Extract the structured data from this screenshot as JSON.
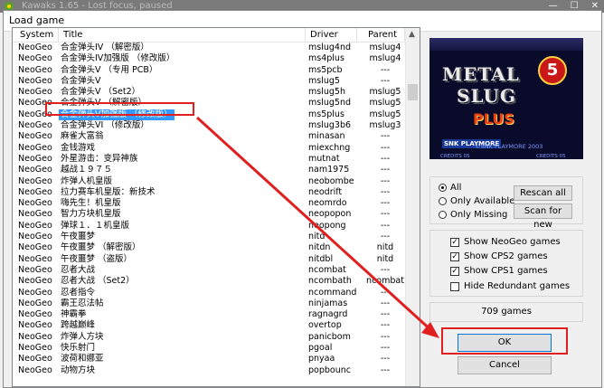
{
  "window": {
    "background_title": "Kawaks 1.65 - Lost focus, paused",
    "controls": [
      "—",
      "☐",
      "✕"
    ]
  },
  "dialog": {
    "title": "Load game"
  },
  "list": {
    "columns": {
      "system": "System",
      "title": "Title",
      "driver": "Driver",
      "parent": "Parent"
    },
    "rows": [
      {
        "system": "NeoGeo",
        "title": "合金弹头IV （解密版）",
        "driver": "mslug4nd",
        "parent": "mslug4"
      },
      {
        "system": "NeoGeo",
        "title": "合金弹头IV加强版 （修改版）",
        "driver": "ms4plus",
        "parent": "mslug4"
      },
      {
        "system": "NeoGeo",
        "title": "合金弹头V （专用 PCB）",
        "driver": "ms5pcb",
        "parent": "---"
      },
      {
        "system": "NeoGeo",
        "title": "合金弹头V",
        "driver": "mslug5",
        "parent": "---"
      },
      {
        "system": "NeoGeo",
        "title": "合金弹头V （Set2）",
        "driver": "mslug5h",
        "parent": "mslug5"
      },
      {
        "system": "NeoGeo",
        "title": "合金弹头V （解密版）",
        "driver": "mslug5nd",
        "parent": "mslug5"
      },
      {
        "system": "NeoGeo",
        "title": "合金弹头V加强版 （修改版）",
        "driver": "ms5plus",
        "parent": "mslug5",
        "selected": true
      },
      {
        "system": "NeoGeo",
        "title": "合金弹头VI （修改版）",
        "driver": "mslug3b6",
        "parent": "mslug3"
      },
      {
        "system": "NeoGeo",
        "title": "麻雀大富翁",
        "driver": "minasan",
        "parent": "---"
      },
      {
        "system": "NeoGeo",
        "title": "金钱游戏",
        "driver": "miexchng",
        "parent": "---"
      },
      {
        "system": "NeoGeo",
        "title": "外星游击：变异神族",
        "driver": "mutnat",
        "parent": "---"
      },
      {
        "system": "NeoGeo",
        "title": "越战１９７５",
        "driver": "nam1975",
        "parent": "---"
      },
      {
        "system": "NeoGeo",
        "title": "炸弹人机皇版",
        "driver": "neobombe",
        "parent": "---"
      },
      {
        "system": "NeoGeo",
        "title": "拉力赛车机皇版：新技术",
        "driver": "neodrift",
        "parent": "---"
      },
      {
        "system": "NeoGeo",
        "title": "嗨先生！机皇版",
        "driver": "neomrdo",
        "parent": "---"
      },
      {
        "system": "NeoGeo",
        "title": "智力方块机皇版",
        "driver": "neopopon",
        "parent": "---"
      },
      {
        "system": "NeoGeo",
        "title": "弹球１．１机皇版",
        "driver": "neopong",
        "parent": "---"
      },
      {
        "system": "NeoGeo",
        "title": "午夜噩梦",
        "driver": "nitd",
        "parent": "---"
      },
      {
        "system": "NeoGeo",
        "title": "午夜噩梦 （解密版）",
        "driver": "nitdn",
        "parent": "nitd"
      },
      {
        "system": "NeoGeo",
        "title": "午夜噩梦 （盗版）",
        "driver": "nitdbl",
        "parent": "nitd"
      },
      {
        "system": "NeoGeo",
        "title": "忍者大战",
        "driver": "ncombat",
        "parent": "---"
      },
      {
        "system": "NeoGeo",
        "title": "忍者大战 （Set2）",
        "driver": "ncombath",
        "parent": "ncombat"
      },
      {
        "system": "NeoGeo",
        "title": "忍者指令",
        "driver": "ncommand",
        "parent": "---"
      },
      {
        "system": "NeoGeo",
        "title": "霸王忍法帖",
        "driver": "ninjamas",
        "parent": "---"
      },
      {
        "system": "NeoGeo",
        "title": "神霸拳",
        "driver": "ragnagrd",
        "parent": "---"
      },
      {
        "system": "NeoGeo",
        "title": "跨越巅峰",
        "driver": "overtop",
        "parent": "---"
      },
      {
        "system": "NeoGeo",
        "title": "炸弹人方块",
        "driver": "panicbom",
        "parent": "---"
      },
      {
        "system": "NeoGeo",
        "title": "快乐射门",
        "driver": "pgoal",
        "parent": "---"
      },
      {
        "system": "NeoGeo",
        "title": "波荷和娜亚",
        "driver": "pnyaa",
        "parent": "---"
      },
      {
        "system": "NeoGeo",
        "title": "动物方块",
        "driver": "popbounc",
        "parent": "---"
      }
    ]
  },
  "preview": {
    "line1": "METAL",
    "line2": "SLUG",
    "badge": "5",
    "subtitle": "PLUS",
    "snk": "SNK PLAYMORE",
    "copyright": "©SNK PLAYMORE 2003",
    "credits_left": "CREDITS 05",
    "credits_right": "CREDITS 05"
  },
  "filter": {
    "all": "All",
    "only_available": "Only Available",
    "only_missing": "Only Missing",
    "rescan": "Rescan all",
    "scan_new": "Scan for new"
  },
  "options": {
    "neogeo": "Show NeoGeo games",
    "cps2": "Show CPS2 games",
    "cps1": "Show CPS1 games",
    "redundant": "Hide Redundant games"
  },
  "game_count": "709 games",
  "buttons": {
    "ok": "OK",
    "cancel": "Cancel"
  },
  "colors": {
    "selection": "#3399ff",
    "highlight": "#e02020"
  }
}
